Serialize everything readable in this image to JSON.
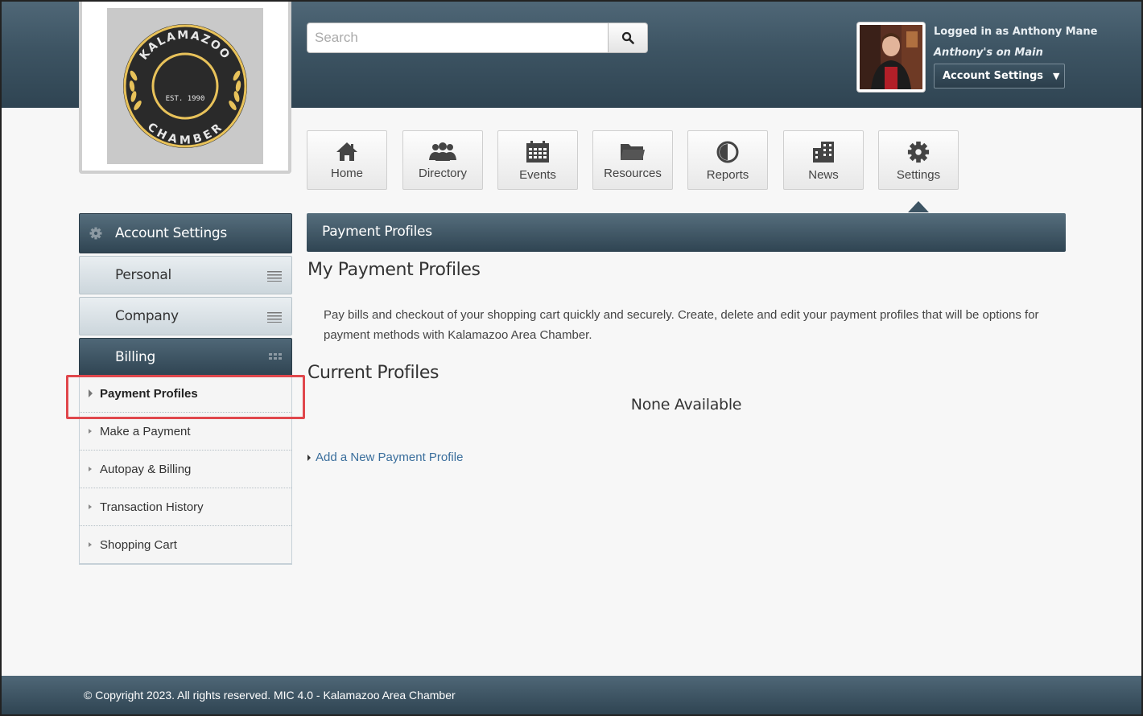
{
  "logo": {
    "top_text": "KALAMAZOO",
    "middle_text": "EST. 1990",
    "bottom_text": "CHAMBER",
    "ring_color": "#e8c25a",
    "dark_color": "#2a2a2a"
  },
  "search": {
    "placeholder": "Search",
    "value": "",
    "icon": "search-icon"
  },
  "user": {
    "logged_in_label": "Logged in as Anthony Mane",
    "context_label": "Anthony's on Main",
    "account_button_label": "Account Settings"
  },
  "topnav": {
    "items": [
      {
        "label": "Home",
        "icon": "home-icon"
      },
      {
        "label": "Directory",
        "icon": "people-icon"
      },
      {
        "label": "Events",
        "icon": "calendar-icon"
      },
      {
        "label": "Resources",
        "icon": "folder-icon"
      },
      {
        "label": "Reports",
        "icon": "pie-chart-icon"
      },
      {
        "label": "News",
        "icon": "building-icon"
      },
      {
        "label": "Settings",
        "icon": "gear-icon"
      }
    ],
    "active": "Settings"
  },
  "sidebar": {
    "header_label": "Account Settings",
    "sections": [
      {
        "label": "Personal"
      },
      {
        "label": "Company"
      },
      {
        "label": "Billing"
      }
    ],
    "billing_items": [
      {
        "label": "Payment Profiles"
      },
      {
        "label": "Make a Payment"
      },
      {
        "label": "Autopay & Billing"
      },
      {
        "label": "Transaction History"
      },
      {
        "label": "Shopping Cart"
      }
    ],
    "current_item": "Payment Profiles"
  },
  "main": {
    "panel_title": "Payment Profiles",
    "heading": "My Payment Profiles",
    "description": "Pay bills and checkout of your shopping cart quickly and securely. Create, delete and edit your payment profiles that will be options for payment methods with Kalamazoo Area Chamber.",
    "current_heading": "Current Profiles",
    "empty_text": "None Available",
    "add_link_label": "Add a New Payment Profile"
  },
  "footer": {
    "text": "© Copyright 2023. All rights reserved. MIC 4.0 - Kalamazoo Area Chamber"
  },
  "colors": {
    "header_dark": "#2f4452",
    "header_light": "#4f6777",
    "link": "#3a6e9c",
    "highlight": "#e0474c"
  }
}
